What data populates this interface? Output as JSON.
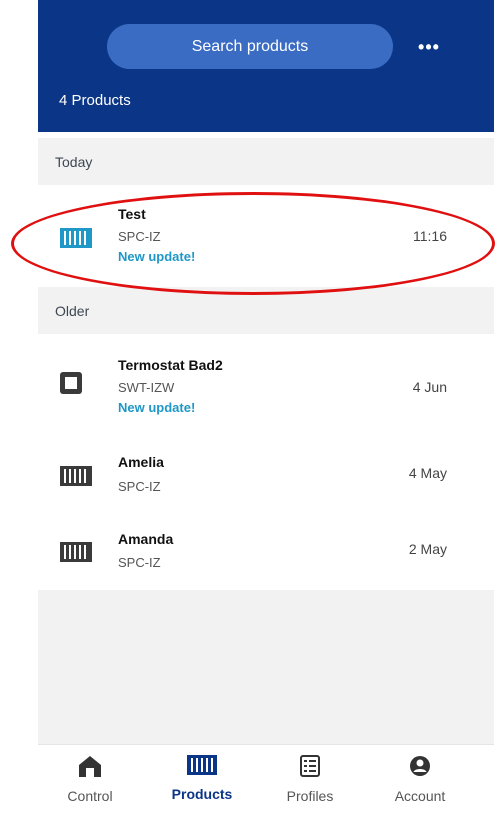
{
  "header": {
    "search_label": "Search products",
    "more_label": "•••",
    "count_label": "4 Products"
  },
  "sections": {
    "today": "Today",
    "older": "Older"
  },
  "products": [
    {
      "name": "Test",
      "model": "SPC-IZ",
      "badge": "New update!",
      "time": "11:16",
      "icon": "radiator-icon-active"
    },
    {
      "name": "Termostat Bad2",
      "model": "SWT-IZW",
      "badge": "New update!",
      "time": "4 Jun",
      "icon": "thermostat-icon"
    },
    {
      "name": "Amelia",
      "model": "SPC-IZ",
      "time": "4 May",
      "icon": "radiator-icon"
    },
    {
      "name": "Amanda",
      "model": "SPC-IZ",
      "time": "2 May",
      "icon": "radiator-icon"
    }
  ],
  "nav": [
    {
      "label": "Control",
      "icon": "home-icon",
      "active": false
    },
    {
      "label": "Products",
      "icon": "radiator-icon",
      "active": true
    },
    {
      "label": "Profiles",
      "icon": "profiles-icon",
      "active": false
    },
    {
      "label": "Account",
      "icon": "account-icon",
      "active": false
    }
  ],
  "colors": {
    "header_bg": "#0b3687",
    "search_bg": "#3b6cc3",
    "badge": "#1f97c7",
    "active_icon": "#1f97c7",
    "annotation": "#e01010"
  }
}
